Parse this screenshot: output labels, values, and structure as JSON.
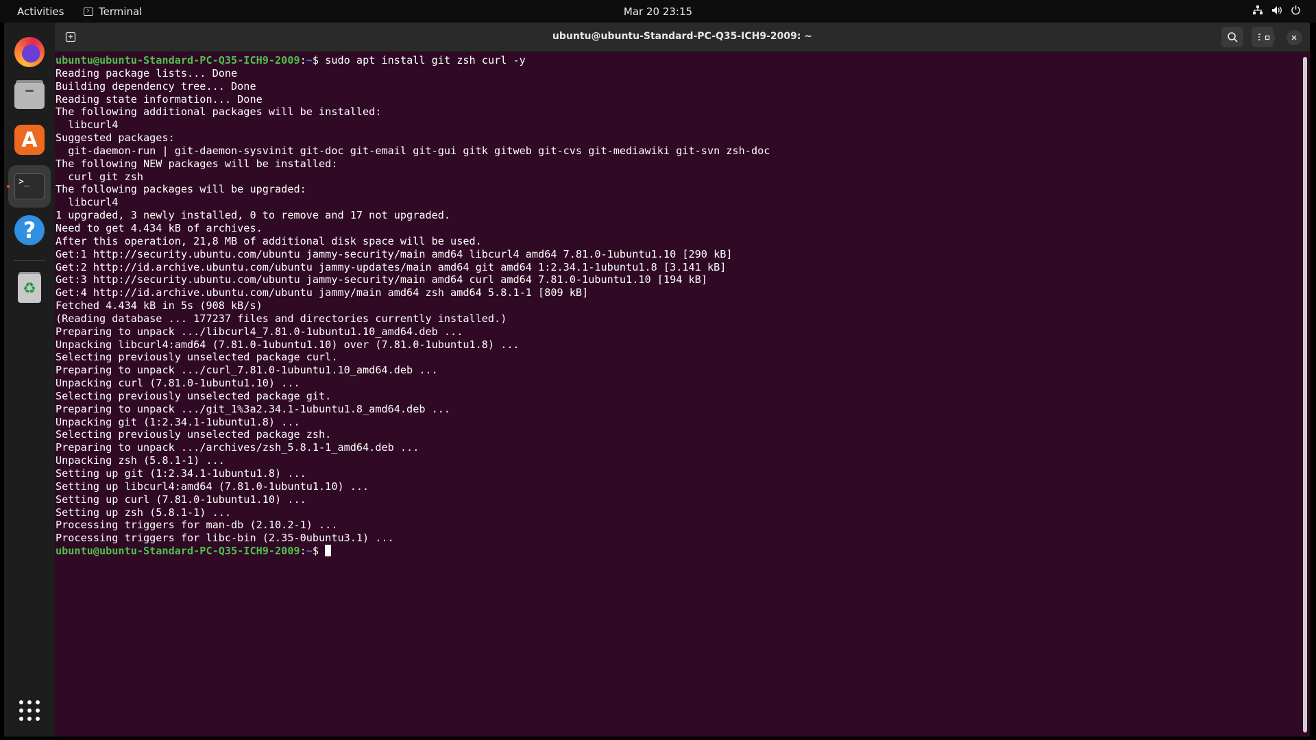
{
  "topbar": {
    "activities": "Activities",
    "app_name": "Terminal",
    "clock": "Mar 20  23:15"
  },
  "dock": {
    "items": [
      "firefox",
      "files",
      "app-center",
      "terminal",
      "help",
      "trash"
    ]
  },
  "window": {
    "title": "ubuntu@ubuntu-Standard-PC-Q35-ICH9-2009: ~"
  },
  "terminal": {
    "prompt_user": "ubuntu@ubuntu-Standard-PC-Q35-ICH9-2009",
    "prompt_path": "~",
    "command": "sudo apt install git zsh curl -y",
    "output": [
      "Reading package lists... Done",
      "Building dependency tree... Done",
      "Reading state information... Done",
      "The following additional packages will be installed:",
      "  libcurl4",
      "Suggested packages:",
      "  git-daemon-run | git-daemon-sysvinit git-doc git-email git-gui gitk gitweb git-cvs git-mediawiki git-svn zsh-doc",
      "The following NEW packages will be installed:",
      "  curl git zsh",
      "The following packages will be upgraded:",
      "  libcurl4",
      "1 upgraded, 3 newly installed, 0 to remove and 17 not upgraded.",
      "Need to get 4.434 kB of archives.",
      "After this operation, 21,8 MB of additional disk space will be used.",
      "Get:1 http://security.ubuntu.com/ubuntu jammy-security/main amd64 libcurl4 amd64 7.81.0-1ubuntu1.10 [290 kB]",
      "Get:2 http://id.archive.ubuntu.com/ubuntu jammy-updates/main amd64 git amd64 1:2.34.1-1ubuntu1.8 [3.141 kB]",
      "Get:3 http://security.ubuntu.com/ubuntu jammy-security/main amd64 curl amd64 7.81.0-1ubuntu1.10 [194 kB]",
      "Get:4 http://id.archive.ubuntu.com/ubuntu jammy/main amd64 zsh amd64 5.8.1-1 [809 kB]",
      "Fetched 4.434 kB in 5s (908 kB/s)",
      "(Reading database ... 177237 files and directories currently installed.)",
      "Preparing to unpack .../libcurl4_7.81.0-1ubuntu1.10_amd64.deb ...",
      "Unpacking libcurl4:amd64 (7.81.0-1ubuntu1.10) over (7.81.0-1ubuntu1.8) ...",
      "Selecting previously unselected package curl.",
      "Preparing to unpack .../curl_7.81.0-1ubuntu1.10_amd64.deb ...",
      "Unpacking curl (7.81.0-1ubuntu1.10) ...",
      "Selecting previously unselected package git.",
      "Preparing to unpack .../git_1%3a2.34.1-1ubuntu1.8_amd64.deb ...",
      "Unpacking git (1:2.34.1-1ubuntu1.8) ...",
      "Selecting previously unselected package zsh.",
      "Preparing to unpack .../archives/zsh_5.8.1-1_amd64.deb ...",
      "Unpacking zsh (5.8.1-1) ...",
      "Setting up git (1:2.34.1-1ubuntu1.8) ...",
      "Setting up libcurl4:amd64 (7.81.0-1ubuntu1.10) ...",
      "Setting up curl (7.81.0-1ubuntu1.10) ...",
      "Setting up zsh (5.8.1-1) ...",
      "Processing triggers for man-db (2.10.2-1) ...",
      "Processing triggers for libc-bin (2.35-0ubuntu3.1) ..."
    ]
  },
  "colors": {
    "terminal_bg": "#300a24",
    "prompt_user": "#4fbf4f",
    "prompt_path": "#3a7fd6",
    "accent": "#e95420"
  }
}
